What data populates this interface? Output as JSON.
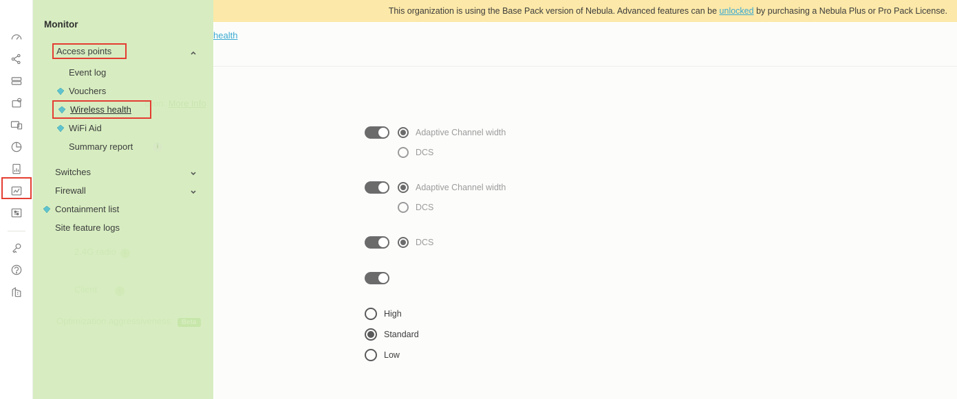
{
  "banner": {
    "prefix": "This organization is using the Base Pack version of Nebula. Advanced features can be ",
    "link": "unlocked",
    "suffix": " by purchasing a Nebula Plus or Pro Pack License."
  },
  "breadcrumb": {
    "last": "health"
  },
  "menu": {
    "title": "Monitor",
    "access_points": "Access points",
    "event_log": "Event log",
    "vouchers": "Vouchers",
    "wireless_health": "Wireless health",
    "wifi_aid": "WiFi Aid",
    "summary_report": "Summary report",
    "switches": "Switches",
    "firewall": "Firewall",
    "containment": "Containment list",
    "site_feature_logs": "Site feature logs"
  },
  "ghost": {
    "section_label": "ction:",
    "section_link": "More Info",
    "radio_24": "2.4G radio",
    "client": "Client",
    "opt_aggr": "Optimization aggressiveness:",
    "beta": "Beta"
  },
  "settings": {
    "adaptive": "Adaptive Channel width",
    "dcs": "DCS",
    "high": "High",
    "standard": "Standard",
    "low": "Low"
  }
}
